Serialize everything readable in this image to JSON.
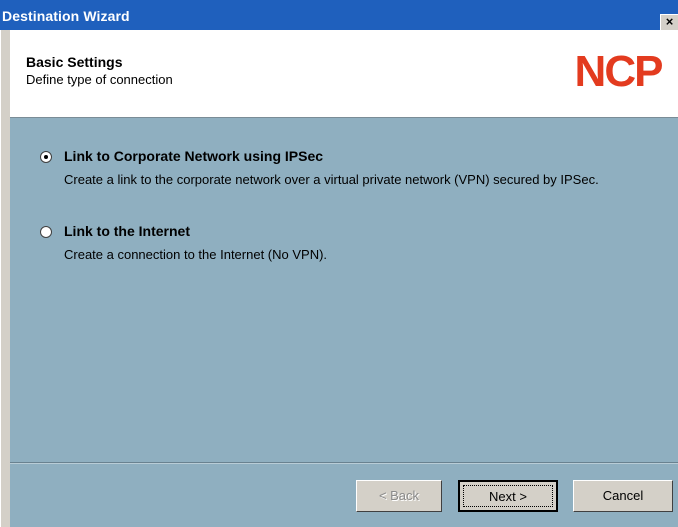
{
  "window": {
    "title": "Destination Wizard",
    "close_glyph": "×"
  },
  "header": {
    "title": "Basic Settings",
    "subtitle": "Define type of connection",
    "logo_text": "NCP",
    "logo_color": "#e33b1f"
  },
  "options": [
    {
      "label": "Link to Corporate Network using IPSec",
      "description": "Create a link to the corporate network over a virtual private network (VPN) secured by IPSec.",
      "selected": true
    },
    {
      "label": "Link to the Internet",
      "description": "Create a connection to the Internet (No VPN).",
      "selected": false
    }
  ],
  "buttons": {
    "back_label": "< Back",
    "next_label": "Next >",
    "cancel_label": "Cancel"
  },
  "colors": {
    "titlebar": "#1f60bd",
    "body": "#8fafc0"
  }
}
